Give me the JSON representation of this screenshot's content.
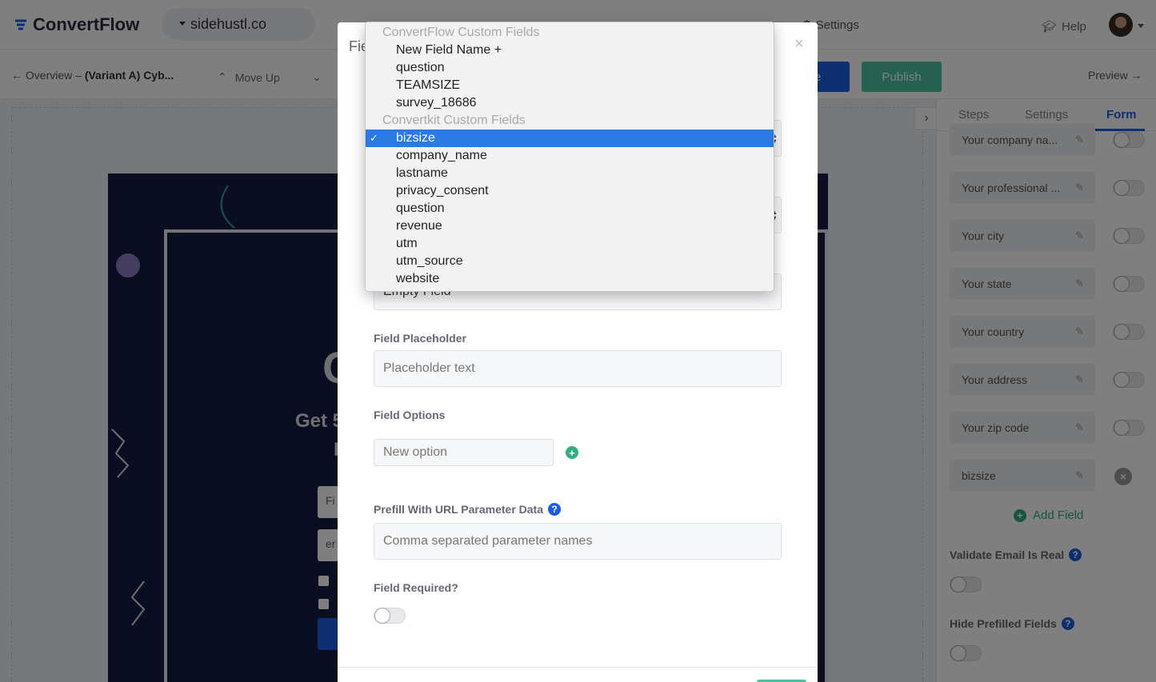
{
  "app": {
    "brand": "ConvertFlow",
    "workspace": "sidehustl.co",
    "nav_settings": "Settings",
    "help": "Help"
  },
  "toolbar": {
    "back_prefix": "← Overview – ",
    "back_title": "(Variant A) Cyb...",
    "move_up": "Move Up",
    "save": "e",
    "publish": "Publish",
    "preview": "Preview →"
  },
  "preview_card": {
    "big_letter": "C",
    "get_text": "Get 5",
    "line_letter": "F",
    "input1_text": "Fi",
    "input2_text": "er"
  },
  "sidebar": {
    "tabs": [
      "Steps",
      "Settings",
      "Form"
    ],
    "fields": [
      {
        "label": "Your company na..."
      },
      {
        "label": "Your professional ..."
      },
      {
        "label": "Your city"
      },
      {
        "label": "Your state"
      },
      {
        "label": "Your country"
      },
      {
        "label": "Your address"
      },
      {
        "label": "Your zip code"
      },
      {
        "label": "bizsize"
      }
    ],
    "add_field": "Add Field",
    "validate_email": "Validate Email Is Real",
    "hide_prefilled": "Hide Prefilled Fields"
  },
  "modal": {
    "title": "Fie",
    "close": "×",
    "empty_field_value": "Empty Field",
    "placeholder_label": "Field Placeholder",
    "placeholder_value": "Placeholder text",
    "options_label": "Field Options",
    "options_placeholder": "New option",
    "prefill_label": "Prefill With URL Parameter Data",
    "prefill_placeholder": "Comma separated parameter names",
    "required_label": "Field Required?"
  },
  "dropdown": {
    "groups": [
      {
        "label": "ConvertFlow Custom Fields",
        "options": [
          "New Field Name +",
          "question",
          "TEAMSIZE",
          "survey_18686"
        ]
      },
      {
        "label": "Convertkit Custom Fields",
        "options": [
          "bizsize",
          "company_name",
          "lastname",
          "privacy_consent",
          "question",
          "revenue",
          "utm",
          "utm_source",
          "website"
        ]
      }
    ],
    "selected": "bizsize"
  },
  "colors": {
    "primary": "#1b5ce0",
    "success": "#48c2a0",
    "green_icon": "#2fae7e",
    "selection": "#2a7ae2",
    "card_bg": "#171a47"
  }
}
